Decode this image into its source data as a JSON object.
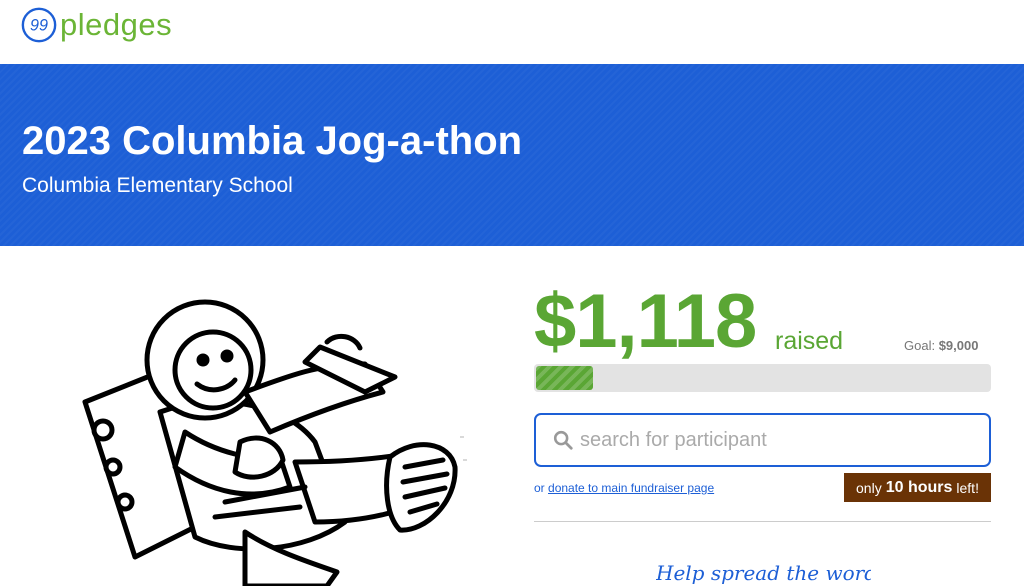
{
  "header": {
    "logo_mark": "99",
    "logo_text": "pledges"
  },
  "hero": {
    "title": "2023 Columbia Jog-a-thon",
    "subtitle": "Columbia Elementary School"
  },
  "fundraiser": {
    "amount": "$1,118",
    "raised_label": "raised",
    "goal_label": "Goal:",
    "goal_value": "$9,000",
    "progress_fraction": 0.124
  },
  "search": {
    "placeholder": "search for participant",
    "value": ""
  },
  "donate": {
    "prefix": "or",
    "link_text": "donate to main fundraiser page"
  },
  "countdown": {
    "prefix": "only",
    "value": "10 hours",
    "suffix": "left!"
  },
  "share": {
    "heading": "Help spread the word"
  },
  "colors": {
    "brand_blue": "#1d5fd6",
    "brand_green": "#5aa634",
    "countdown_brown": "#6a3306"
  },
  "icons": {
    "search": "search-icon",
    "illustration": "astronaut-illustration"
  }
}
